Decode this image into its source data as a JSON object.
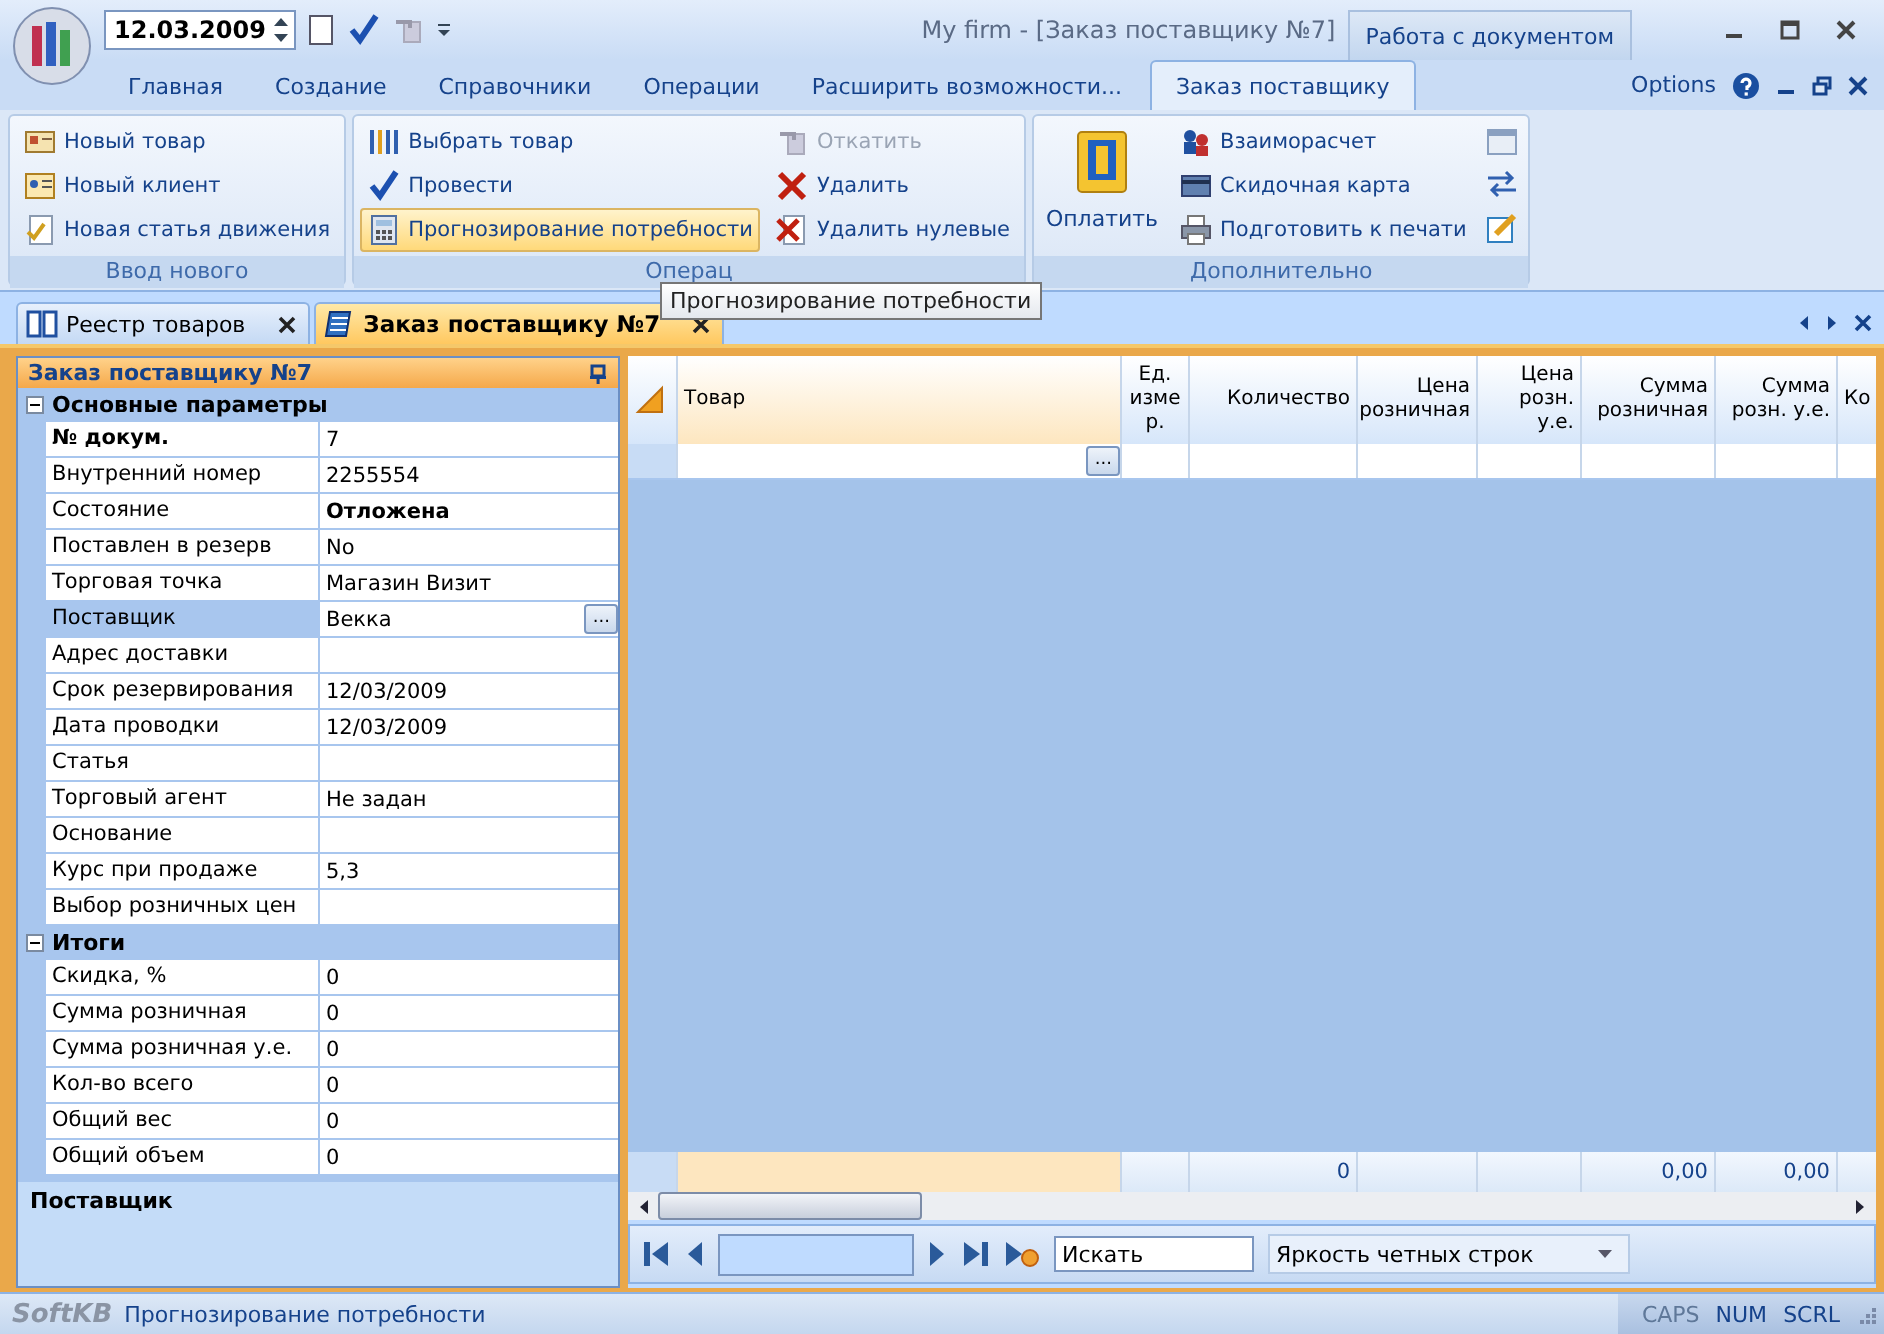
{
  "title_bar": {
    "date": "12.03.2009",
    "title": "My firm - [Заказ поставщику №7]",
    "context_group": "Работа с документом"
  },
  "ribbon_tabs": [
    {
      "label": "Главная",
      "selected": false
    },
    {
      "label": "Создание",
      "selected": false
    },
    {
      "label": "Справочники",
      "selected": false
    },
    {
      "label": "Операции",
      "selected": false
    },
    {
      "label": "Расширить возможности...",
      "selected": false
    },
    {
      "label": "Заказ поставщику",
      "selected": true
    }
  ],
  "options_label": "Options",
  "ribbon_groups": [
    {
      "label": "Ввод нового",
      "items": [
        {
          "label": "Новый товар",
          "disabled": false,
          "hover": false
        },
        {
          "label": "Новый клиент",
          "disabled": false,
          "hover": false
        },
        {
          "label": "Новая статья движения",
          "disabled": false,
          "hover": false
        }
      ]
    },
    {
      "label": "Операц",
      "items": [
        {
          "label": "Выбрать товар",
          "disabled": false,
          "hover": false
        },
        {
          "label": "Провести",
          "disabled": false,
          "hover": false
        },
        {
          "label": "Прогнозирование потребности",
          "disabled": false,
          "hover": true
        },
        {
          "label": "Откатить",
          "disabled": true,
          "hover": false
        },
        {
          "label": "Удалить",
          "disabled": false,
          "hover": false
        },
        {
          "label": "Удалить нулевые",
          "disabled": false,
          "hover": false
        }
      ]
    },
    {
      "label": "Дополнительно",
      "large": {
        "label": "Оплатить"
      },
      "items": [
        {
          "label": "Взаиморасчет",
          "disabled": false,
          "hover": false
        },
        {
          "label": "Скидочная карта",
          "disabled": false,
          "hover": false
        },
        {
          "label": "Подготовить к печати",
          "disabled": false,
          "hover": false
        }
      ]
    }
  ],
  "tooltip": "Прогнозирование потребности",
  "doc_tabs": [
    {
      "label": "Реестр товаров",
      "selected": false
    },
    {
      "label": "Заказ поставщику №7",
      "selected": true
    }
  ],
  "property_panel": {
    "title": "Заказ поставщику №7",
    "categories": [
      {
        "name": "Основные параметры",
        "expanded": true,
        "rows": [
          {
            "label": "№ докум.",
            "value": "7",
            "bold": true,
            "selected": false
          },
          {
            "label": "Внутренний номер",
            "value": "2255554",
            "bold": false,
            "selected": false
          },
          {
            "label": "Состояние",
            "value": "Отложена",
            "bold": false,
            "value_bold": true,
            "selected": false
          },
          {
            "label": "Поставлен в резерв",
            "value": "No",
            "bold": false,
            "selected": false
          },
          {
            "label": "Торговая точка",
            "value": "Магазин Визит",
            "bold": false,
            "selected": false
          },
          {
            "label": "Поставщик",
            "value": "Векка",
            "button": "...",
            "bold": false,
            "selected": true
          },
          {
            "label": "Адрес доставки",
            "bold": false,
            "selected": false
          },
          {
            "label": "Срок резервирования",
            "value": "12/03/2009",
            "bold": false,
            "selected": false
          },
          {
            "label": "Дата проводки",
            "value": "12/03/2009",
            "bold": false,
            "selected": false
          },
          {
            "label": "Статья",
            "bold": false,
            "selected": false
          },
          {
            "label": "Торговый агент",
            "value": "Не задан",
            "bold": false,
            "selected": false
          },
          {
            "label": "Основание",
            "bold": false,
            "selected": false
          },
          {
            "label": "Курс при продаже",
            "value": "5,3",
            "bold": false,
            "selected": false
          },
          {
            "label": "Выбор розничных цен",
            "bold": false,
            "selected": false
          }
        ]
      },
      {
        "name": "Итоги",
        "expanded": true,
        "rows": [
          {
            "label": "Скидка, %",
            "value": "0",
            "bold": false,
            "selected": false
          },
          {
            "label": "Сумма розничная",
            "value": "0",
            "bold": false,
            "selected": false
          },
          {
            "label": "Сумма розничная у.е.",
            "value": "0",
            "bold": false,
            "selected": false
          },
          {
            "label": "Кол-во всего",
            "value": "0",
            "bold": false,
            "selected": false
          },
          {
            "label": "Общий вес",
            "value": "0",
            "bold": false,
            "selected": false
          },
          {
            "label": "Общий объем",
            "value": "0",
            "bold": false,
            "selected": false
          }
        ]
      }
    ],
    "description": "Поставщик"
  },
  "grid": {
    "columns": [
      {
        "label": "Товар",
        "filter_button": "..."
      },
      {
        "label": "Ед. изме р."
      },
      {
        "label": "Количество",
        "footer": "0"
      },
      {
        "label": "Цена розничная"
      },
      {
        "label": "Цена розн. у.е."
      },
      {
        "label": "Сумма розничная",
        "footer": "0,00"
      },
      {
        "label": "Сумма розн. у.е.",
        "footer": "0,00"
      },
      {
        "label": "Ко"
      }
    ],
    "search_placeholder": "Искать",
    "dropdown": "Яркость четных строк"
  },
  "status_bar": {
    "logo": "SoftKB",
    "message": "Прогнозирование потребности",
    "indicators": [
      {
        "label": "CAPS",
        "on": false
      },
      {
        "label": "NUM",
        "on": true
      },
      {
        "label": "SCRL",
        "on": true
      }
    ]
  }
}
